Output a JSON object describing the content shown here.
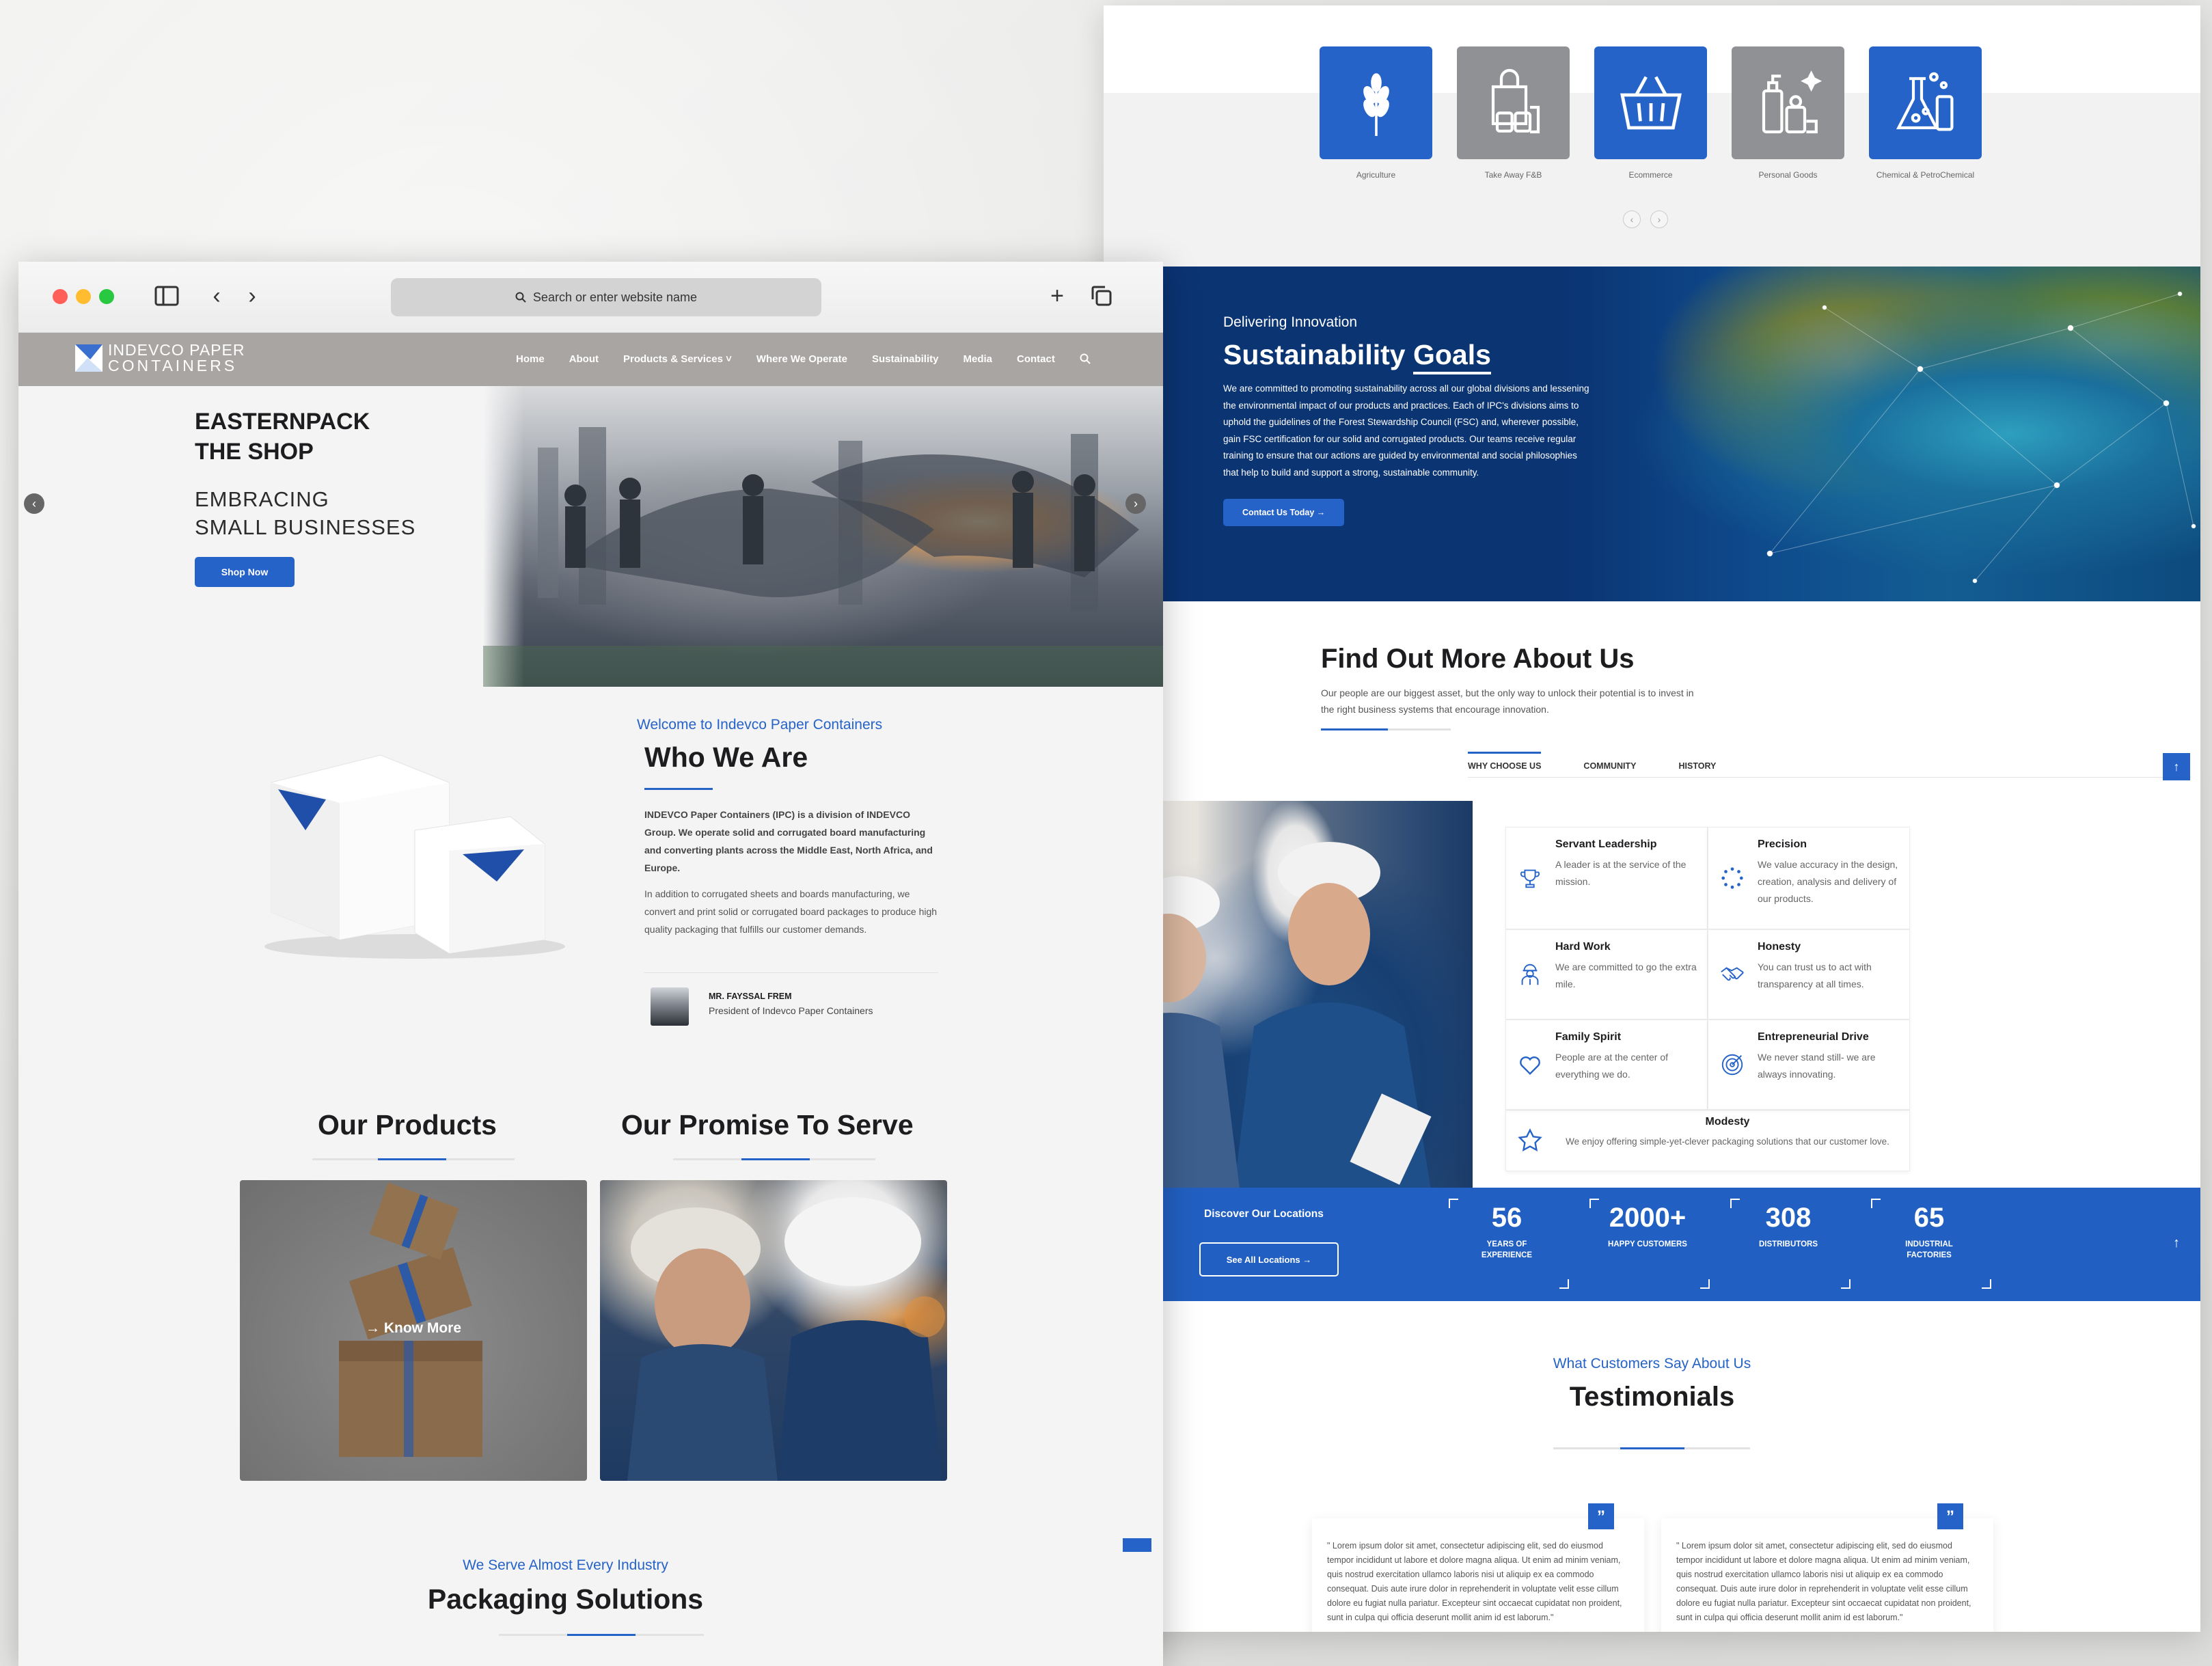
{
  "industries": {
    "items": [
      {
        "label": "Agriculture",
        "icon": "wheat-icon",
        "tone": "blue"
      },
      {
        "label": "Take Away F&B",
        "icon": "takeaway-bag-icon",
        "tone": "gray"
      },
      {
        "label": "Ecommerce",
        "icon": "basket-icon",
        "tone": "blue"
      },
      {
        "label": "Personal Goods",
        "icon": "personal-goods-icon",
        "tone": "gray"
      },
      {
        "label": "Chemical & PetroChemical",
        "icon": "chemistry-flask-icon",
        "tone": "blue"
      }
    ]
  },
  "sustainability": {
    "eyebrow": "Delivering Innovation",
    "title_main": "Sustainability ",
    "title_underlined": "Goals",
    "body": "We are committed to promoting sustainability across all our global divisions and lessening the environmental impact of our products and practices. Each of IPC's divisions aims to uphold the guidelines of the Forest Stewardship Council (FSC) and, wherever possible, gain FSC certification for our solid and corrugated products. Our teams receive regular training to ensure that our actions are guided by environmental and social philosophies that help to build and support a strong, sustainable community.",
    "cta": "Contact Us Today →"
  },
  "about": {
    "title": "Find Out More About Us",
    "subtitle": "Our people are our biggest asset, but the only way to unlock their potential is to invest in the right business systems that encourage innovation.",
    "tabs": [
      "WHY CHOOSE US",
      "COMMUNITY",
      "HISTORY"
    ],
    "top_button": "↑",
    "values": [
      {
        "title": "Servant Leadership",
        "desc": "A leader is at the service of the mission.",
        "icon": "trophy-icon"
      },
      {
        "title": "Precision",
        "desc": "We value accuracy in the design, creation, analysis and delivery of our products.",
        "icon": "precision-dots-icon"
      },
      {
        "title": "Hard Work",
        "desc": "We are committed to go the extra mile.",
        "icon": "worker-icon"
      },
      {
        "title": "Honesty",
        "desc": "You can trust us to act with transparency at all times.",
        "icon": "handshake-icon"
      },
      {
        "title": "Family Spirit",
        "desc": "People are at the center of everything we do.",
        "icon": "heart-icon"
      },
      {
        "title": "Entrepreneurial Drive",
        "desc": "We never stand still- we are always innovating.",
        "icon": "target-icon"
      }
    ],
    "modesty": {
      "title": "Modesty",
      "desc": "We enjoy offering simple-yet-clever packaging solutions that our customer love.",
      "icon": "star-icon"
    }
  },
  "stats": {
    "discover": "Discover Our Locations",
    "button": "See All Locations →",
    "items": [
      {
        "num": "56",
        "label": "YEARS OF\nEXPERIENCE"
      },
      {
        "num": "2000+",
        "label": "HAPPY CUSTOMERS"
      },
      {
        "num": "308",
        "label": "DISTRIBUTORS"
      },
      {
        "num": "65",
        "label": "INDUSTRIAL\nFACTORIES"
      }
    ],
    "up_arrow": "↑"
  },
  "testimonials": {
    "eyebrow": "What Customers Say About Us",
    "title": "Testimonials",
    "quote_mark": "”",
    "quotes": [
      "\" Lorem ipsum dolor sit amet, consectetur adipiscing elit, sed do eiusmod tempor incididunt ut labore et dolore magna aliqua. Ut enim ad minim veniam, quis nostrud exercitation ullamco laboris nisi ut aliquip ex ea commodo consequat. Duis aute irure dolor in reprehenderit in voluptate velit esse cillum dolore eu fugiat nulla pariatur. Excepteur sint occaecat cupidatat non proident, sunt in culpa qui officia deserunt mollit anim id est laborum.\"",
      "\" Lorem ipsum dolor sit amet, consectetur adipiscing elit, sed do eiusmod tempor incididunt ut labore et dolore magna aliqua. Ut enim ad minim veniam, quis nostrud exercitation ullamco laboris nisi ut aliquip ex ea commodo consequat. Duis aute irure dolor in reprehenderit in voluptate velit esse cillum dolore eu fugiat nulla pariatur. Excepteur sint occaecat cupidatat non proident, sunt in culpa qui officia deserunt mollit anim id est laborum.\""
    ]
  },
  "browser": {
    "url_placeholder": "Search or enter website name",
    "dots": [
      "#ff5f57",
      "#febc2e",
      "#28c840"
    ]
  },
  "site": {
    "logo_line1": "INDEVCO PAPER",
    "logo_line2": "CONTAINERS",
    "nav": [
      "Home",
      "About",
      "Products & Services ˅",
      "Where We Operate",
      "Sustainability",
      "Media",
      "Contact"
    ]
  },
  "hero": {
    "line1": "EASTERNPACK",
    "line2": "THE SHOP",
    "line3": "EMBRACING",
    "line4": "SMALL BUSINESSES",
    "button": "Shop Now",
    "prev": "‹",
    "next": "›"
  },
  "who": {
    "eyebrow": "Welcome to Indevco Paper Containers",
    "title": "Who We Are",
    "p1": "INDEVCO Paper Containers (IPC) is a division of  INDEVCO Group. We operate solid and corrugated board manufacturing and converting plants across the Middle East, North Africa, and Europe.",
    "p2": "In addition to corrugated sheets and boards manufacturing, we convert and print solid or corrugated board packages to produce high quality packaging that fulfills our customer demands.",
    "president_name": "MR. FAYSSAL FREM",
    "president_role": "President of Indevco Paper Containers"
  },
  "products": {
    "title": "Our Products",
    "promise_title": "Our Promise To Serve",
    "know_more": "→ Know More"
  },
  "packaging": {
    "eyebrow": "We Serve Almost Every Industry",
    "title": "Packaging Solutions"
  },
  "colors": {
    "brand_blue": "#2563c8",
    "navy": "#0b3473",
    "nav_gray": "#a9a5a3"
  }
}
